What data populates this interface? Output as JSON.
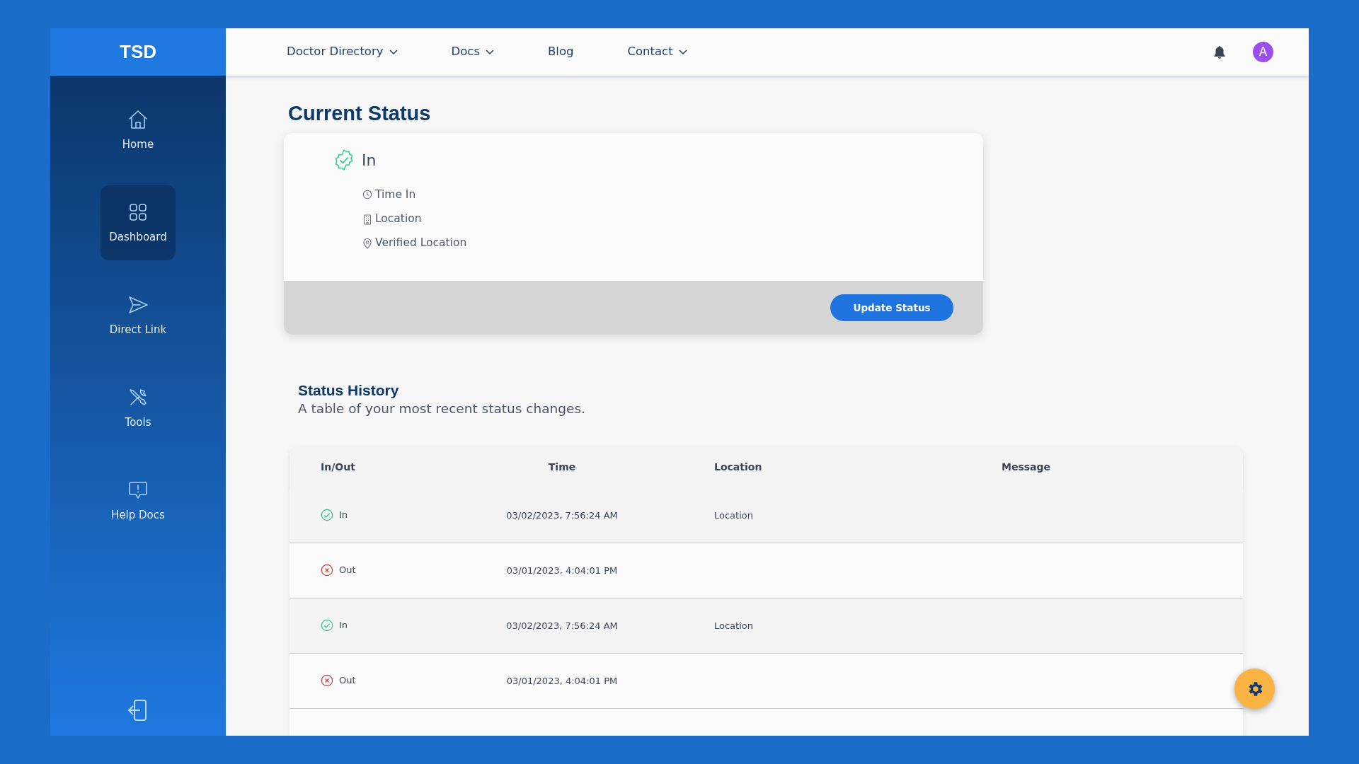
{
  "brand": "TSD",
  "nav": [
    {
      "label": "Doctor Directory",
      "dropdown": true
    },
    {
      "label": "Docs",
      "dropdown": true
    },
    {
      "label": "Blog",
      "dropdown": false
    },
    {
      "label": "Contact",
      "dropdown": true
    }
  ],
  "avatar": "A",
  "sidebar": {
    "items": [
      {
        "label": "Home",
        "selected": false
      },
      {
        "label": "Dashboard",
        "selected": true
      },
      {
        "label": "Direct Link",
        "selected": false
      },
      {
        "label": "Tools",
        "selected": false
      },
      {
        "label": "Help Docs",
        "selected": false
      }
    ]
  },
  "current_status": {
    "title": "Current Status",
    "status": {
      "kind": "in",
      "label": "In"
    },
    "details": [
      "Time In",
      "Location",
      "Verified Location"
    ],
    "button": "Update Status"
  },
  "history": {
    "title": "Status History",
    "subtitle": "A table of your most recent status changes.",
    "columns": [
      "In/Out",
      "Time",
      "Location",
      "Message"
    ],
    "rows": [
      {
        "kind": "in",
        "label": "In",
        "time": "03/02/2023, 7:56:24 AM",
        "location": "Location"
      },
      {
        "kind": "out",
        "label": "Out",
        "time": "03/01/2023, 4:04:01 PM",
        "location": ""
      },
      {
        "kind": "in",
        "label": "In",
        "time": "03/02/2023, 7:56:24 AM",
        "location": "Location"
      },
      {
        "kind": "out",
        "label": "Out",
        "time": "03/01/2023, 4:04:01 PM",
        "location": ""
      }
    ]
  }
}
